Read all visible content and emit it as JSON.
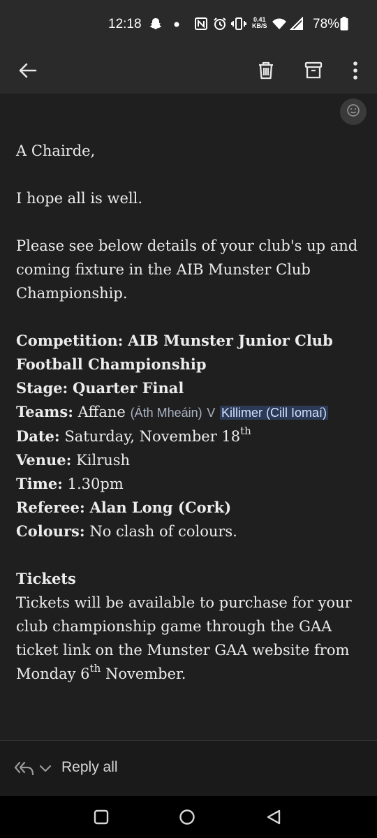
{
  "status_bar": {
    "time": "12:18",
    "data_rate_value": "0.41",
    "data_rate_unit": "KB/S",
    "battery_pct": "78%",
    "icons": [
      "snapchat-icon",
      "dot-icon",
      "nfc-icon",
      "alarm-icon",
      "vibrate-icon",
      "data-rate-icon",
      "wifi-icon",
      "signal-icon",
      "battery-icon"
    ]
  },
  "app_bar": {
    "icons": [
      "back-arrow-icon",
      "trash-icon",
      "archive-icon",
      "more-vert-icon"
    ]
  },
  "email": {
    "greeting": "A Chairde,",
    "line1": "I hope all is well.",
    "intro": "Please see below details of your club's up and coming fixture in the AIB Munster Club Championship.",
    "competition_label": "Competition:",
    "competition_value": "AIB Munster Junior Club Football Championship",
    "stage_label": "Stage:",
    "stage_value": "Quarter Final",
    "teams_label": "Teams:",
    "team1": "Affane",
    "team1_irish": "(Áth Mheáin)",
    "versus": "V",
    "team2": "Killimer (Cill Iomaí)",
    "date_label": "Date:",
    "date_value": "Saturday, November 18",
    "date_suffix": "th",
    "venue_label": "Venue:",
    "venue_value": "Kilrush",
    "time_label": "Time:",
    "time_value": "1.30pm",
    "referee_label": "Referee:",
    "referee_value": "Alan Long (Cork)",
    "colours_label": "Colours:",
    "colours_value": "No clash of colours.",
    "tickets_heading": "Tickets",
    "tickets_text": "Tickets will be available to purchase for your club championship game through the GAA ticket link on the Munster GAA website from Monday 6",
    "tickets_suffix": "th",
    "tickets_end": "November."
  },
  "reply_bar": {
    "label": "Reply all"
  },
  "nav_bar": {
    "icons": [
      "recents-square-icon",
      "home-circle-icon",
      "back-triangle-icon"
    ]
  }
}
